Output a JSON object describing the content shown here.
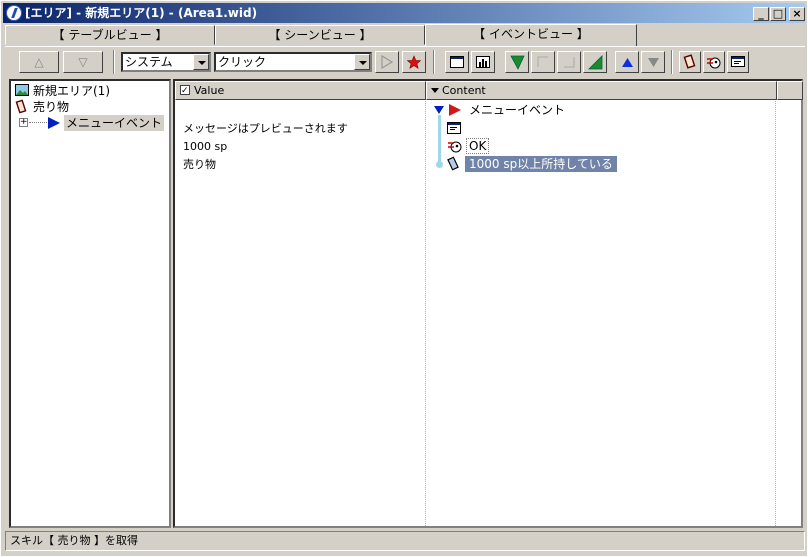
{
  "window": {
    "title": "[エリア] - 新規エリア(1) - (Area1.wid)",
    "min_label": "_",
    "max_label": "□",
    "close_label": "×"
  },
  "tabs": [
    {
      "label": "【 テーブルビュー 】"
    },
    {
      "label": "【 シーンビュー 】"
    },
    {
      "label": "【 イベントビュー 】",
      "active": true
    }
  ],
  "toolbar": {
    "up_label": "△",
    "down_label": "▽",
    "category_select": "システム",
    "action_select": "クリック"
  },
  "tree": {
    "items": [
      {
        "label": "新規エリア(1)",
        "icon": "area-icon"
      },
      {
        "label": "売り物",
        "icon": "card-icon"
      },
      {
        "label": "メニューイベント",
        "icon": "event-icon",
        "expander": "+"
      }
    ]
  },
  "list": {
    "columns": [
      {
        "label": "Value"
      },
      {
        "label": "Content"
      }
    ],
    "values": [
      "メッセージはプレビューされます",
      "1000 sp",
      "売り物"
    ],
    "content": [
      {
        "label": "メニューイベント",
        "icon": "start-icon"
      },
      {
        "label": "",
        "icon": "message-icon"
      },
      {
        "label": "OK",
        "icon": "branch-icon"
      },
      {
        "label": "1000 sp以上所持している",
        "icon": "money-check-icon",
        "selected": true
      }
    ]
  },
  "status": {
    "text": "スキル【 売り物 】を取得"
  },
  "colors": {
    "title_start": "#0a246a",
    "title_end": "#a6caf0",
    "selection": "#6f84a8",
    "event_triangle": "#0020c0",
    "start_flag": "#d01818"
  }
}
